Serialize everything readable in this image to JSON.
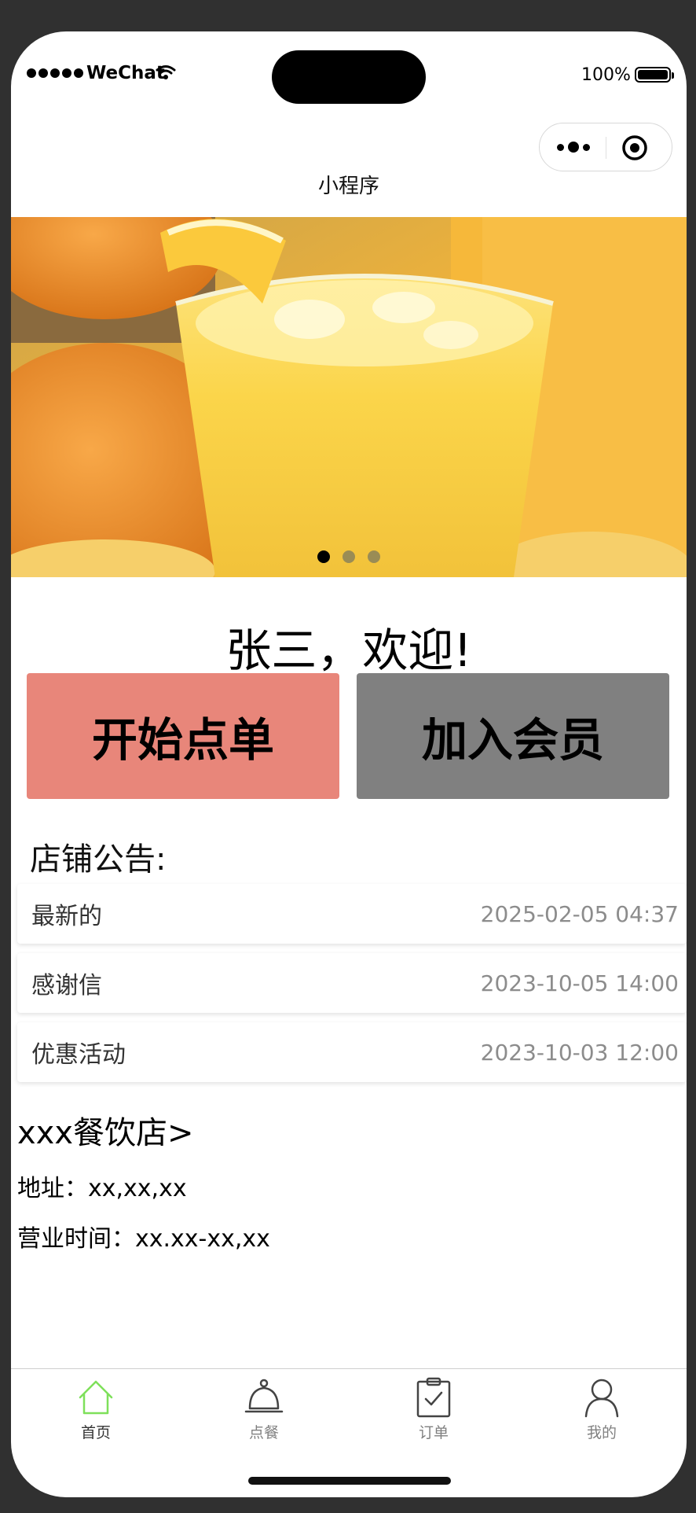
{
  "status_bar": {
    "carrier": "WeChat",
    "battery": "100%"
  },
  "nav": {
    "title": "小程序"
  },
  "banner": {
    "slides": 3,
    "active_slide": 1,
    "dot_colors": [
      "#000000",
      "#9a8c55",
      "#9a8c55"
    ]
  },
  "welcome": {
    "text": "张三，欢迎!"
  },
  "buttons": {
    "order_label": "开始点单",
    "order_color": "#e8867a",
    "member_label": "加入会员",
    "member_color": "#808080"
  },
  "notices": {
    "title": "店铺公告:",
    "items": [
      {
        "title": "最新的",
        "date": "2025-02-05 04:37"
      },
      {
        "title": "感谢信",
        "date": "2023-10-05 14:00"
      },
      {
        "title": "优惠活动",
        "date": "2023-10-03 12:00"
      }
    ]
  },
  "store": {
    "name": "xxx餐饮店>",
    "address": "地址：xx,xx,xx",
    "hours": "营业时间：xx.xx-xx,xx"
  },
  "tabbar": {
    "active_color": "#7ee05a",
    "inactive_color": "#808080",
    "items": [
      {
        "label": "首页",
        "icon": "home-icon",
        "active": true
      },
      {
        "label": "点餐",
        "icon": "serving-bell-icon",
        "active": false
      },
      {
        "label": "订单",
        "icon": "clipboard-check-icon",
        "active": false
      },
      {
        "label": "我的",
        "icon": "user-icon",
        "active": false
      }
    ]
  }
}
